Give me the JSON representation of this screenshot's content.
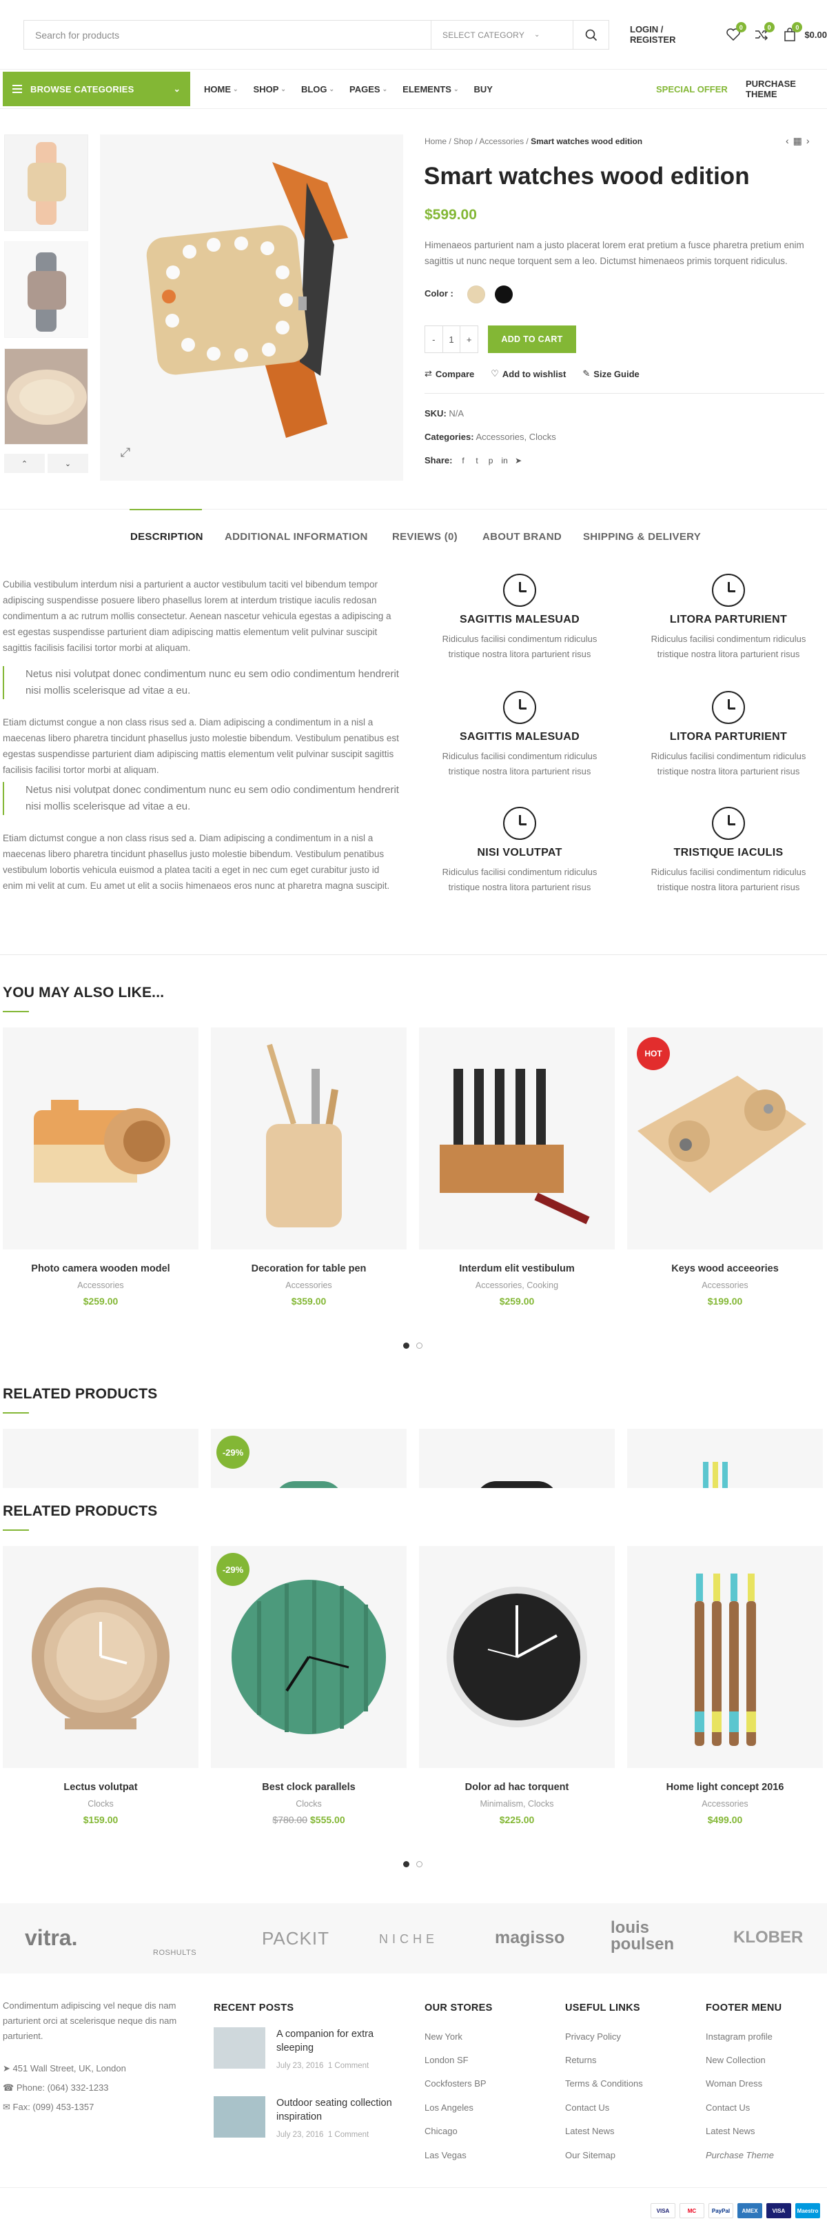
{
  "header": {
    "search_placeholder": "Search for products",
    "select_category": "SELECT CATEGORY",
    "login": "LOGIN / REGISTER",
    "wishlist_count": "0",
    "compare_count": "0",
    "cart_count": "0",
    "cart_total": "$0.00"
  },
  "nav": {
    "browse": "BROWSE CATEGORIES",
    "items": [
      "HOME",
      "SHOP",
      "BLOG",
      "PAGES",
      "ELEMENTS",
      "BUY"
    ],
    "special_offer": "SPECIAL OFFER",
    "purchase_theme": "PURCHASE THEME"
  },
  "product": {
    "breadcrumb": [
      "Home",
      "Shop",
      "Accessories",
      "Smart watches wood edition"
    ],
    "title": "Smart watches wood edition",
    "price": "$599.00",
    "description": "Himenaeos parturient nam a justo placerat lorem erat pretium a fusce pharetra pretium enim sagittis ut nunc neque torquent sem a leo. Dictumst himenaeos primis torquent ridiculus.",
    "color_label": "Color :",
    "colors": [
      "#e8d5b0",
      "#111111"
    ],
    "quantity": "1",
    "qty_minus": "-",
    "qty_plus": "+",
    "add_to_cart": "ADD TO CART",
    "compare": "Compare",
    "wishlist": "Add to wishlist",
    "size_guide": "Size Guide",
    "sku_label": "SKU:",
    "sku": "N/A",
    "categories_label": "Categories:",
    "categories": "Accessories, Clocks",
    "share_label": "Share:"
  },
  "tabs": [
    "DESCRIPTION",
    "ADDITIONAL INFORMATION",
    "REVIEWS (0)",
    "ABOUT BRAND",
    "SHIPPING & DELIVERY"
  ],
  "description": {
    "p1": "Cubilia vestibulum interdum nisi a parturient a auctor vestibulum taciti vel bibendum tempor adipiscing suspendisse posuere libero phasellus lorem at interdum tristique iaculis redosan condimentum a ac rutrum mollis consectetur. Aenean nascetur vehicula egestas a adipiscing a est egestas suspendisse parturient diam adipiscing mattis elementum velit pulvinar suscipit sagittis facilisis facilisi tortor morbi at aliquam.",
    "quote1": "Netus nisi volutpat donec condimentum nunc eu sem odio condimentum hendrerit nisi mollis scelerisque ad vitae a eu.",
    "p2": "Etiam dictumst congue a non class risus sed a. Diam adipiscing a condimentum in a nisl a maecenas libero pharetra tincidunt phasellus justo molestie bibendum. Vestibulum penatibus est egestas suspendisse parturient diam adipiscing mattis elementum velit pulvinar suscipit sagittis facilisis facilisi tortor morbi at aliquam.",
    "quote2": "Netus nisi volutpat donec condimentum nunc eu sem odio condimentum hendrerit nisi mollis scelerisque ad vitae a eu.",
    "p3": "Etiam dictumst congue a non class risus sed a. Diam adipiscing a condimentum in a nisl a maecenas libero pharetra tincidunt phasellus justo molestie bibendum. Vestibulum penatibus vestibulum lobortis vehicula euismod a platea taciti a eget in nec cum eget curabitur justo id enim mi velit at cum. Eu amet ut elit a sociis himenaeos eros nunc at pharetra magna suscipit."
  },
  "features": [
    {
      "title": "SAGITTIS MALESUAD",
      "text": "Ridiculus facilisi condimentum ridiculus tristique nostra litora parturient risus"
    },
    {
      "title": "LITORA PARTURIENT",
      "text": "Ridiculus facilisi condimentum ridiculus tristique nostra litora parturient risus"
    },
    {
      "title": "SAGITTIS MALESUAD",
      "text": "Ridiculus facilisi condimentum ridiculus tristique nostra litora parturient risus"
    },
    {
      "title": "LITORA PARTURIENT",
      "text": "Ridiculus facilisi condimentum ridiculus tristique nostra litora parturient risus"
    },
    {
      "title": "NISI VOLUTPAT",
      "text": "Ridiculus facilisi condimentum ridiculus tristique nostra litora parturient risus"
    },
    {
      "title": "TRISTIQUE IACULIS",
      "text": "Ridiculus facilisi condimentum ridiculus tristique nostra litora parturient risus"
    }
  ],
  "may_like": {
    "title": "YOU MAY ALSO LIKE...",
    "items": [
      {
        "name": "Photo camera wooden model",
        "cat": "Accessories",
        "price": "$259.00"
      },
      {
        "name": "Decoration for table pen",
        "cat": "Accessories",
        "price": "$359.00"
      },
      {
        "name": "Interdum elit vestibulum",
        "cat": "Accessories, Cooking",
        "price": "$259.00"
      },
      {
        "name": "Keys wood acceeories",
        "cat": "Accessories",
        "price": "$199.00",
        "badge": "HOT"
      }
    ]
  },
  "related": {
    "title": "RELATED PRODUCTS",
    "items": [
      {
        "name": "Lectus volutpat",
        "cat": "Clocks",
        "price": "$159.00"
      },
      {
        "name": "Best clock parallels",
        "cat": "Clocks",
        "old_price": "$780.00",
        "price": "$555.00",
        "badge": "-29%"
      },
      {
        "name": "Dolor ad hac torquent",
        "cat": "Minimalism, Clocks",
        "price": "$225.00"
      },
      {
        "name": "Home light concept 2016",
        "cat": "Accessories",
        "price": "$499.00"
      }
    ]
  },
  "brands": [
    "vitra.",
    "ROSHULTS",
    "PACKIT",
    "NICHE",
    "magisso",
    "louis poulsen",
    "KLOBER"
  ],
  "footer": {
    "about": "Condimentum adipiscing vel neque dis nam parturient orci at scelerisque neque dis nam parturient.",
    "address": "451 Wall Street, UK, London",
    "phone": "Phone: (064) 332-1233",
    "fax": "Fax: (099) 453-1357",
    "recent_posts_title": "RECENT POSTS",
    "posts": [
      {
        "title": "A companion for extra sleeping",
        "date": "July 23, 2016",
        "comments": "1 Comment"
      },
      {
        "title": "Outdoor seating collection inspiration",
        "date": "July 23, 2016",
        "comments": "1 Comment"
      }
    ],
    "stores_title": "OUR STORES",
    "stores": [
      "New York",
      "London SF",
      "Cockfosters BP",
      "Los Angeles",
      "Chicago",
      "Las Vegas"
    ],
    "useful_title": "USEFUL LINKS",
    "useful": [
      "Privacy Policy",
      "Returns",
      "Terms & Conditions",
      "Contact Us",
      "Latest News",
      "Our Sitemap"
    ],
    "menu_title": "FOOTER MENU",
    "menu": [
      "Instagram profile",
      "New Collection",
      "Woman Dress",
      "Contact Us",
      "Latest News",
      "Purchase Theme"
    ]
  },
  "payments": [
    "VISA",
    "MC",
    "PayPal",
    "AMEX",
    "VISA",
    "Maestro"
  ],
  "colors": {
    "accent": "#83b735",
    "hot": "#e22d2d"
  }
}
